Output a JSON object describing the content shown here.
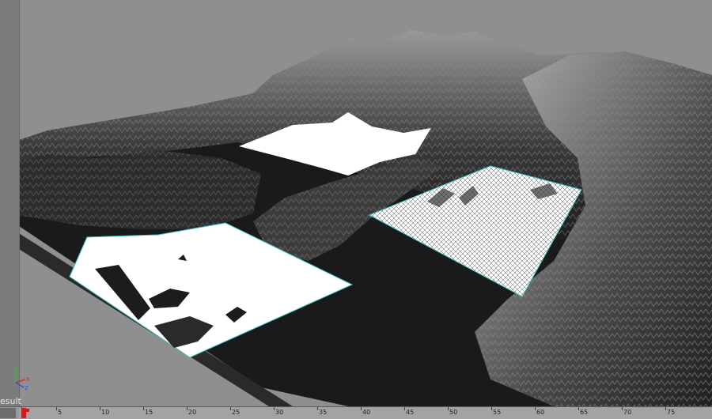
{
  "viewport": {
    "status_text": "esult",
    "axis_labels": {
      "y": "Y",
      "x": "X",
      "z": "Z"
    },
    "colors": {
      "background": "#8f8f8f",
      "terrain_dark": "#1e1e1e",
      "terrain_mid": "#4a4a4a",
      "terrain_light": "#bdbdbd",
      "water_plane": "#ffffff",
      "plane_edge": "#44c8c8",
      "axis_x": "#d03030",
      "axis_y": "#30c030",
      "axis_z": "#3050e0"
    }
  },
  "timeline": {
    "current_frame": 1,
    "tick_labels": [
      "1",
      "5",
      "10",
      "15",
      "20",
      "25",
      "30",
      "35",
      "40",
      "45",
      "50",
      "55",
      "60",
      "65",
      "70",
      "75"
    ]
  }
}
